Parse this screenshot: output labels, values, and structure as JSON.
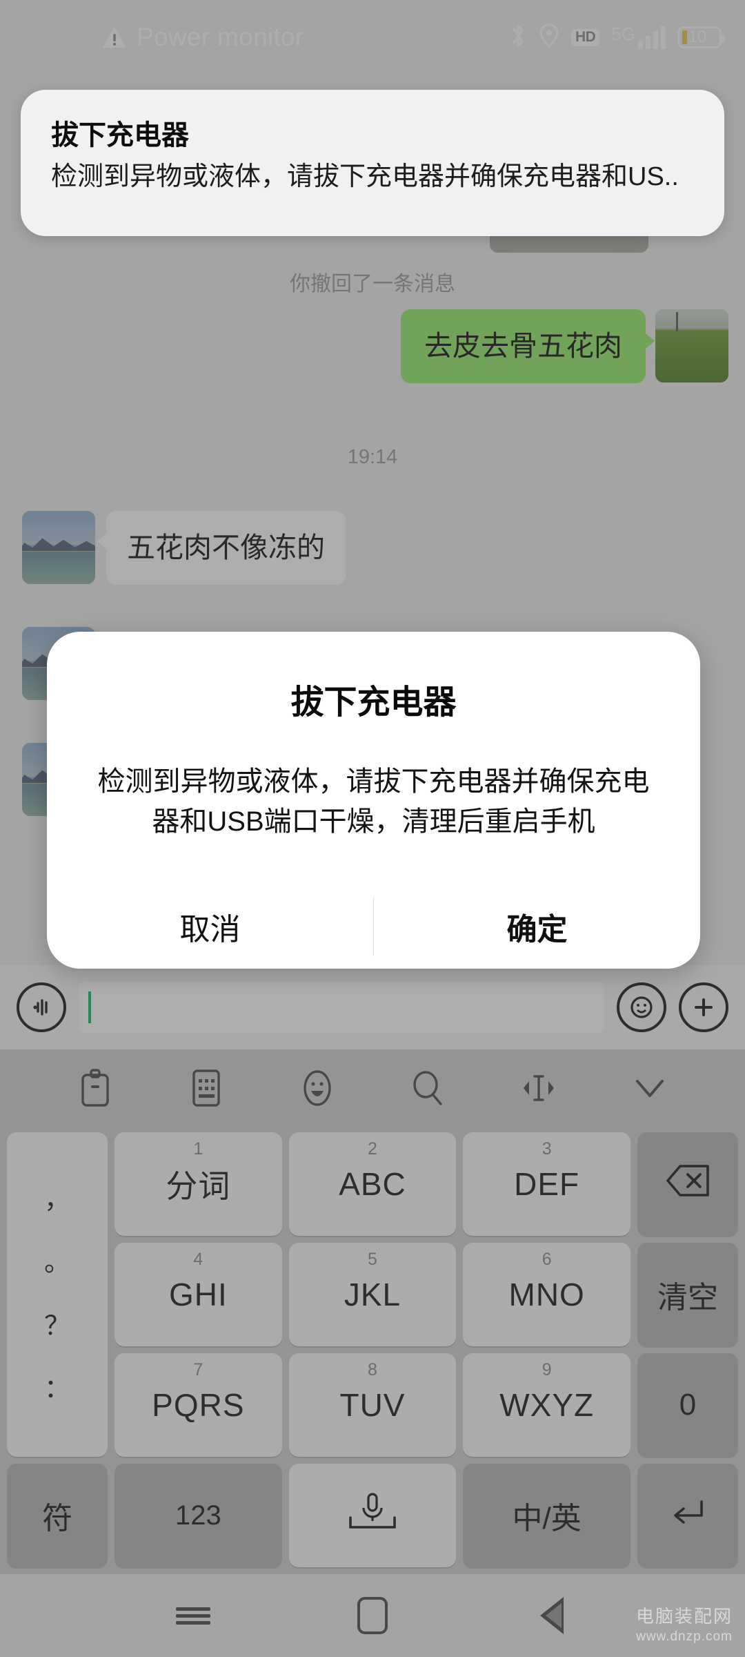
{
  "status_bar": {
    "warning_icon": "warning-triangle-icon",
    "title": "Power monitor",
    "icons": [
      "bluetooth-icon",
      "location-icon",
      "hd-icon"
    ],
    "hd_label": "HD",
    "network_label": "5G",
    "signal_bars": 4,
    "battery_level": "10"
  },
  "notification": {
    "title": "拔下充电器",
    "body": "检测到异物或液体，请拔下充电器并确保充电器和US.."
  },
  "chat": {
    "recalled_note": "你撤回了一条消息",
    "outgoing_text": "去皮去骨五花肉",
    "timestamp": "19:14",
    "incoming_text": "五花肉不像冻的"
  },
  "input_bar": {
    "voice_icon": "voice-input-icon",
    "emoji_icon": "emoji-icon",
    "plus_icon": "plus-icon",
    "text_value": "",
    "placeholder": ""
  },
  "dialog": {
    "title": "拔下充电器",
    "message": "检测到异物或液体，请拔下充电器并确保充电器和USB端口干燥，清理后重启手机",
    "cancel_label": "取消",
    "confirm_label": "确定"
  },
  "keyboard": {
    "toolbar": [
      "clipboard-icon",
      "keyboard-icon",
      "emoji-icon",
      "search-icon",
      "cursor-move-icon",
      "chevron-down-icon"
    ],
    "punctuation": [
      "，",
      "。",
      "？",
      "："
    ],
    "keys": [
      {
        "digit": "1",
        "main": "分词"
      },
      {
        "digit": "2",
        "main": "ABC"
      },
      {
        "digit": "3",
        "main": "DEF"
      },
      {
        "digit": "4",
        "main": "GHI"
      },
      {
        "digit": "5",
        "main": "JKL"
      },
      {
        "digit": "6",
        "main": "MNO"
      },
      {
        "digit": "7",
        "main": "PQRS"
      },
      {
        "digit": "8",
        "main": "TUV"
      },
      {
        "digit": "9",
        "main": "WXYZ"
      }
    ],
    "backspace": "backspace-icon",
    "clear_label": "清空",
    "zero_label": "0",
    "symbol_label": "符",
    "numeric_label": "123",
    "space_icon": "microphone-icon",
    "lang_label": "中/英",
    "enter_icon": "enter-icon"
  },
  "nav_bar": {
    "recents": "recents-icon",
    "home": "home-icon",
    "back": "back-icon"
  },
  "watermark": {
    "name": "电脑装配网",
    "url": "www.dnzp.com"
  },
  "colors": {
    "outgoing_bubble": "#95ec69",
    "accent_green": "#07c160",
    "battery_amber": "#f0c040"
  }
}
